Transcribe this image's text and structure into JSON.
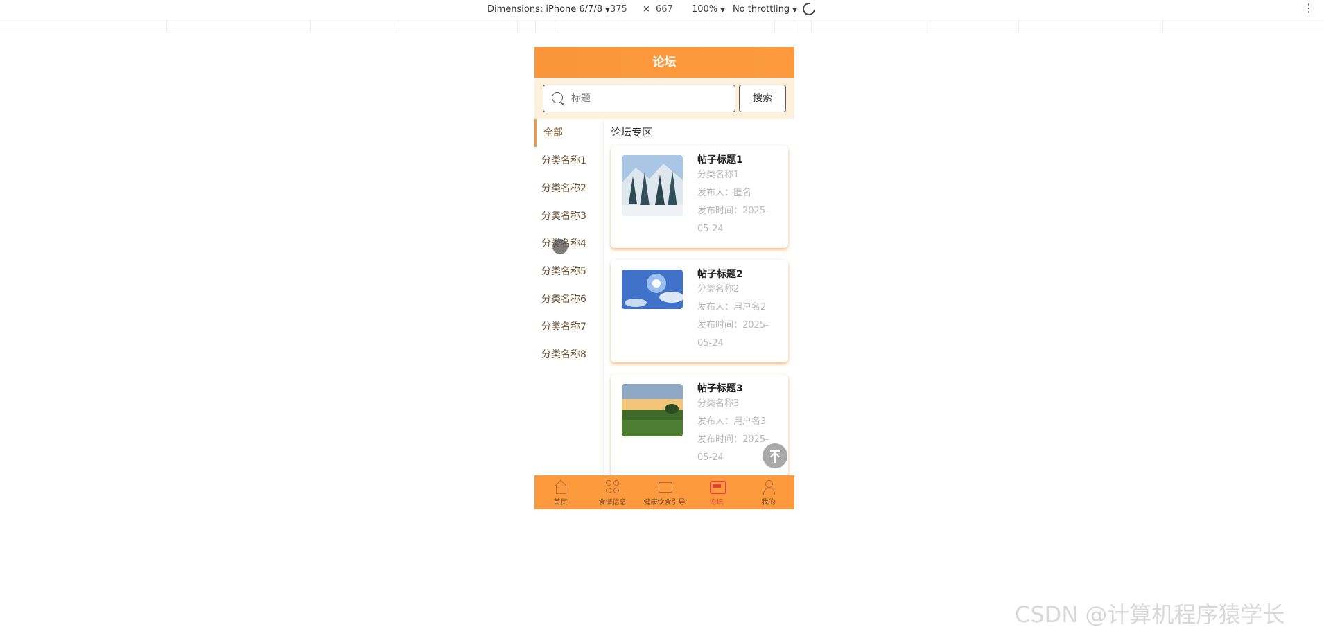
{
  "devtools": {
    "dimensions_label": "Dimensions: iPhone 6/7/8",
    "width": "375",
    "times": "×",
    "height": "667",
    "zoom": "100%",
    "throttling": "No throttling"
  },
  "header": {
    "title": "论坛"
  },
  "search": {
    "placeholder": "标题",
    "button_label": "搜索"
  },
  "sidebar": {
    "items": [
      "全部",
      "分类名称1",
      "分类名称2",
      "分类名称3",
      "分类名称4",
      "分类名称5",
      "分类名称6",
      "分类名称7",
      "分类名称8"
    ],
    "active_index": 0
  },
  "main": {
    "section_title": "论坛专区",
    "posts": [
      {
        "title": "帖子标题1",
        "category": "分类名称1",
        "author": "发布人：匿名",
        "time_line1": "发布时间：2025-",
        "time_line2": "05-24",
        "image": "snowy-forest"
      },
      {
        "title": "帖子标题2",
        "category": "分类名称2",
        "author": "发布人：用户名2",
        "time_line1": "发布时间：2025-",
        "time_line2": "05-24",
        "image": "blue-sky-sun"
      },
      {
        "title": "帖子标题3",
        "category": "分类名称3",
        "author": "发布人：用户名3",
        "time_line1": "发布时间：2025-",
        "time_line2": "05-24",
        "image": "sunset-field"
      }
    ]
  },
  "tabbar": {
    "tabs": [
      {
        "label": "首页",
        "icon": "home-icon"
      },
      {
        "label": "食谱信息",
        "icon": "grid-icon"
      },
      {
        "label": "健康饮食引导",
        "icon": "screen-icon"
      },
      {
        "label": "论坛",
        "icon": "chat-icon"
      },
      {
        "label": "我的",
        "icon": "user-icon"
      }
    ],
    "active_index": 3
  },
  "colors": {
    "primary": "#fd9a3e",
    "search_bg": "#fdf1dd",
    "active_tab": "#e2463a"
  },
  "watermark": "CSDN @计算机程序猿学长"
}
